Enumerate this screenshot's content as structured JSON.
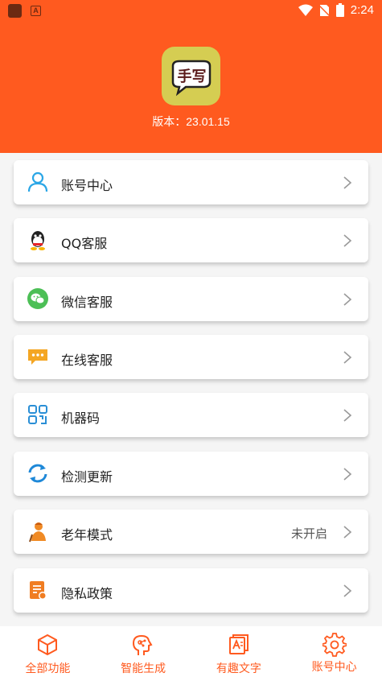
{
  "status_bar": {
    "time": "2:24"
  },
  "header": {
    "app_icon_text": "手写",
    "version": "版本：23.01.15",
    "bg_color": "#ff5a1f"
  },
  "menu": [
    {
      "label": "账号中心",
      "icon": "user-icon",
      "value": ""
    },
    {
      "label": "QQ客服",
      "icon": "qq-icon",
      "value": ""
    },
    {
      "label": "微信客服",
      "icon": "wechat-icon",
      "value": ""
    },
    {
      "label": "在线客服",
      "icon": "chat-bubble-icon",
      "value": ""
    },
    {
      "label": "机器码",
      "icon": "qr-code-icon",
      "value": ""
    },
    {
      "label": "检测更新",
      "icon": "refresh-icon",
      "value": ""
    },
    {
      "label": "老年模式",
      "icon": "elder-icon",
      "value": "未开启"
    },
    {
      "label": "隐私政策",
      "icon": "document-icon",
      "value": ""
    }
  ],
  "tabbar": [
    {
      "label": "全部功能",
      "icon": "cube-icon"
    },
    {
      "label": "智能生成",
      "icon": "ai-head-icon"
    },
    {
      "label": "有趣文字",
      "icon": "text-doc-icon"
    },
    {
      "label": "账号中心",
      "icon": "gear-icon"
    }
  ]
}
